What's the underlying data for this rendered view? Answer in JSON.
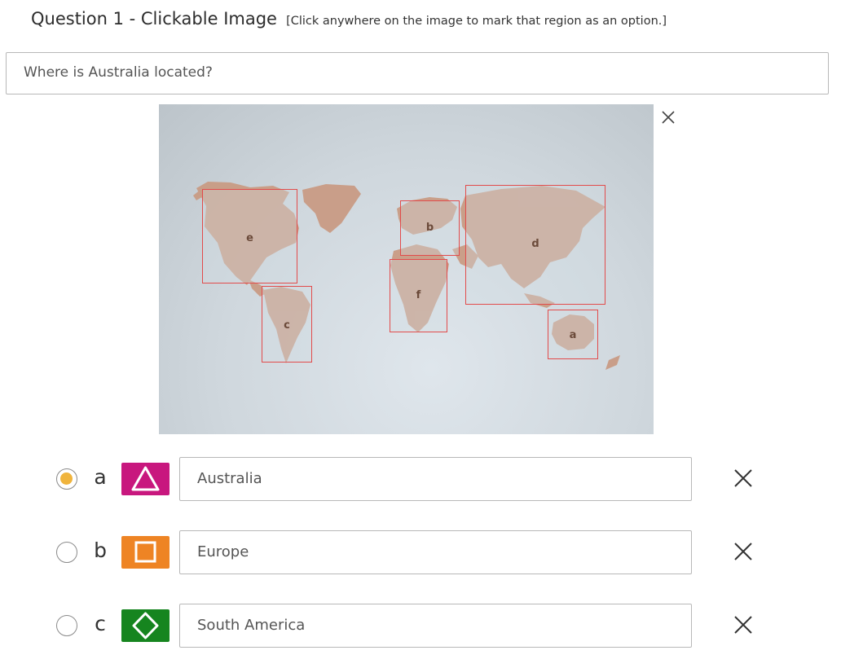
{
  "header": {
    "title": "Question 1 - Clickable Image",
    "hint": "[Click anywhere on the image to mark that region as an option.]"
  },
  "question": {
    "text": "Where is Australia located?"
  },
  "image": {
    "close_icon": "close-icon",
    "regions": [
      {
        "label": "a",
        "name": "australia"
      },
      {
        "label": "b",
        "name": "europe"
      },
      {
        "label": "c",
        "name": "south-america"
      },
      {
        "label": "d",
        "name": "asia"
      },
      {
        "label": "e",
        "name": "north-america"
      },
      {
        "label": "f",
        "name": "africa"
      }
    ]
  },
  "options": [
    {
      "letter": "a",
      "answer": "Australia",
      "shape": "triangle",
      "color": "#c8177e",
      "selected": true
    },
    {
      "letter": "b",
      "answer": "Europe",
      "shape": "square",
      "color": "#ee8424",
      "selected": false
    },
    {
      "letter": "c",
      "answer": "South America",
      "shape": "diamond",
      "color": "#16851f",
      "selected": false
    }
  ],
  "colors": {
    "region_border": "#e24b4b",
    "land": "#c99a82",
    "selected_radio": "#f0b43c"
  }
}
